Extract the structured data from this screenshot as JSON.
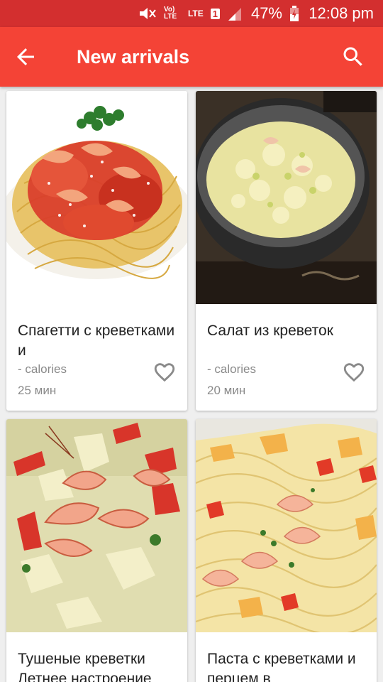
{
  "status_bar": {
    "volte": "Vo) LTE",
    "lte": "LTE",
    "sim": "1",
    "battery_percent": "47%",
    "time": "12:08 pm"
  },
  "app_bar": {
    "title": "New arrivals",
    "back_icon": "arrow-back-icon",
    "search_icon": "search-icon",
    "color": "#f44336",
    "status_color": "#d32f2f"
  },
  "recipes": [
    {
      "name": "Спагетти с креветками и",
      "calories": "- calories",
      "time": "25 мин",
      "favorite_icon": "heart-outline-icon"
    },
    {
      "name": "Салат из креветок",
      "calories": "- calories",
      "time": "20 мин",
      "favorite_icon": "heart-outline-icon"
    },
    {
      "name": "Тушеные креветки Летнее настроение",
      "calories": "",
      "time": "",
      "favorite_icon": ""
    },
    {
      "name": "Паста с креветками и перцем в",
      "calories": "",
      "time": "",
      "favorite_icon": ""
    }
  ]
}
